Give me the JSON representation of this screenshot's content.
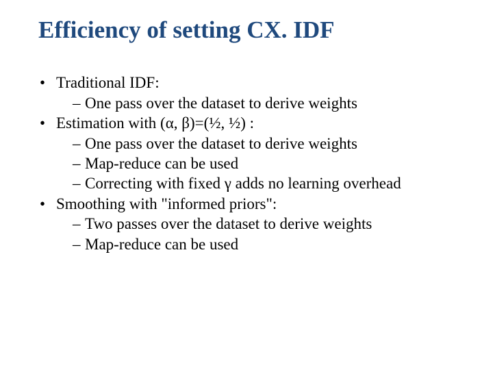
{
  "title": "Efficiency of setting CX. IDF",
  "bullets": [
    {
      "text": "Traditional IDF:",
      "sub": [
        "One pass over the dataset to derive weights"
      ]
    },
    {
      "text": "Estimation with (α, β)=(½, ½) :",
      "sub": [
        "One pass over the dataset to derive weights",
        "Map-reduce can be used",
        "Correcting with fixed γ adds no learning overhead"
      ]
    },
    {
      "text": "Smoothing with \"informed priors\":",
      "sub": [
        "Two passes over the dataset to derive weights",
        "Map-reduce can be used"
      ]
    }
  ]
}
